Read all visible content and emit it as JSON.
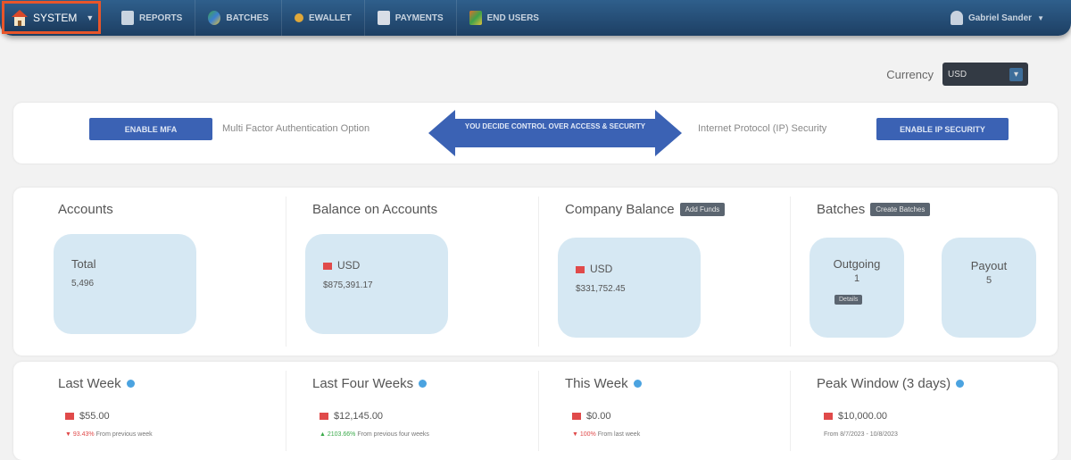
{
  "nav": {
    "system_label": "SYSTEM",
    "items": [
      {
        "label": "REPORTS",
        "icon": "reports-icon",
        "color": "#c8d4e0"
      },
      {
        "label": "BATCHES",
        "icon": "batches-icon",
        "color": "#3fa24a"
      },
      {
        "label": "EWALLET",
        "icon": "ewallet-icon",
        "color": "#e0a83a"
      },
      {
        "label": "PAYMENTS",
        "icon": "payments-icon",
        "color": "#d8dde6"
      },
      {
        "label": "END USERS",
        "icon": "end-users-icon",
        "color": "#d9702e"
      }
    ],
    "user_name": "Gabriel Sander"
  },
  "currency": {
    "label": "Currency",
    "selected": "USD"
  },
  "security": {
    "mfa_button": "ENABLE MFA",
    "mfa_text": "Multi Factor Authentication Option",
    "center_text": "YOU DECIDE CONTROL OVER ACCESS & SECURITY",
    "ip_text": "Internet Protocol (IP) Security",
    "ip_button": "ENABLE IP SECURITY"
  },
  "stats": {
    "accounts": {
      "title": "Accounts",
      "card_label": "Total",
      "card_value": "5,496"
    },
    "balance": {
      "title": "Balance on Accounts",
      "currency": "USD",
      "value": "$875,391.17"
    },
    "company": {
      "title": "Company Balance",
      "tag": "Add Funds",
      "currency": "USD",
      "value": "$331,752.45"
    },
    "batches": {
      "title": "Batches",
      "tag": "Create Batches",
      "outgoing_label": "Outgoing",
      "outgoing_value": "1",
      "outgoing_badge": "Details",
      "payout_label": "Payout",
      "payout_value": "5"
    }
  },
  "weekly": {
    "last_week": {
      "title": "Last Week",
      "value": "$55.00",
      "delta": "93.43%",
      "delta_text": "From previous week"
    },
    "last_four_weeks": {
      "title": "Last Four Weeks",
      "value": "$12,145.00",
      "delta": "2103.66%",
      "delta_text": "From previous four weeks"
    },
    "this_week": {
      "title": "This Week",
      "value": "$0.00",
      "delta": "100%",
      "delta_text": "From last week"
    },
    "peak_window": {
      "title": "Peak Window (3 days)",
      "value": "$10,000.00",
      "sub": "From 8/7/2023 - 10/8/2023"
    }
  }
}
